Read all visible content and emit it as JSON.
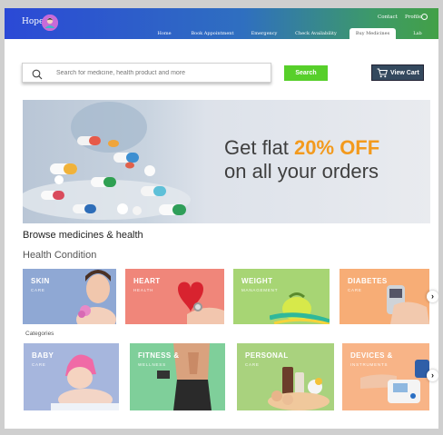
{
  "brand": {
    "name": "Hope"
  },
  "top_links": {
    "contact": "Contact",
    "profile": "Profile"
  },
  "nav": {
    "tabs": [
      {
        "label": "Home"
      },
      {
        "label": "Book Appointment"
      },
      {
        "label": "Emergency"
      },
      {
        "label": "Check Availability"
      },
      {
        "label": "Buy Medicines",
        "active": true
      },
      {
        "label": "Lab Tests"
      }
    ]
  },
  "search": {
    "placeholder": "Search for medicine, health product and more",
    "button_label": "Search"
  },
  "cart": {
    "label": "View Cart"
  },
  "banner": {
    "line1_prefix": "Get flat ",
    "highlight": "20% OFF",
    "line2": "on all your orders",
    "highlight_color": "#f39a1d"
  },
  "browse_title": "Browse medicines & health",
  "health_condition": {
    "title": "Health Condition",
    "cards": [
      {
        "title": "SKIN",
        "subtitle": "CARE",
        "color": "#8fa8d4"
      },
      {
        "title": "HEART",
        "subtitle": "HEALTH",
        "color": "#f0867a"
      },
      {
        "title": "WEIGHT",
        "subtitle": "MANAGEMENT",
        "color": "#a7d574"
      },
      {
        "title": "DIABETES",
        "subtitle": "CARE",
        "color": "#f7ad76"
      }
    ]
  },
  "categories": {
    "title": "Categories",
    "cards": [
      {
        "title": "BABY",
        "subtitle": "CARE",
        "color": "#a6b6dd"
      },
      {
        "title": "FITNESS &",
        "subtitle": "WELLNESS",
        "color": "#7fcf9a"
      },
      {
        "title": "PERSONAL",
        "subtitle": "CARE",
        "color": "#a9d27e"
      },
      {
        "title": "DEVICES &",
        "subtitle": "INSTRUMENTS",
        "color": "#f8b487"
      }
    ]
  },
  "icons": {
    "search": "search-icon",
    "cart": "cart-icon",
    "user": "user-icon",
    "next": "chevron-right-icon"
  }
}
